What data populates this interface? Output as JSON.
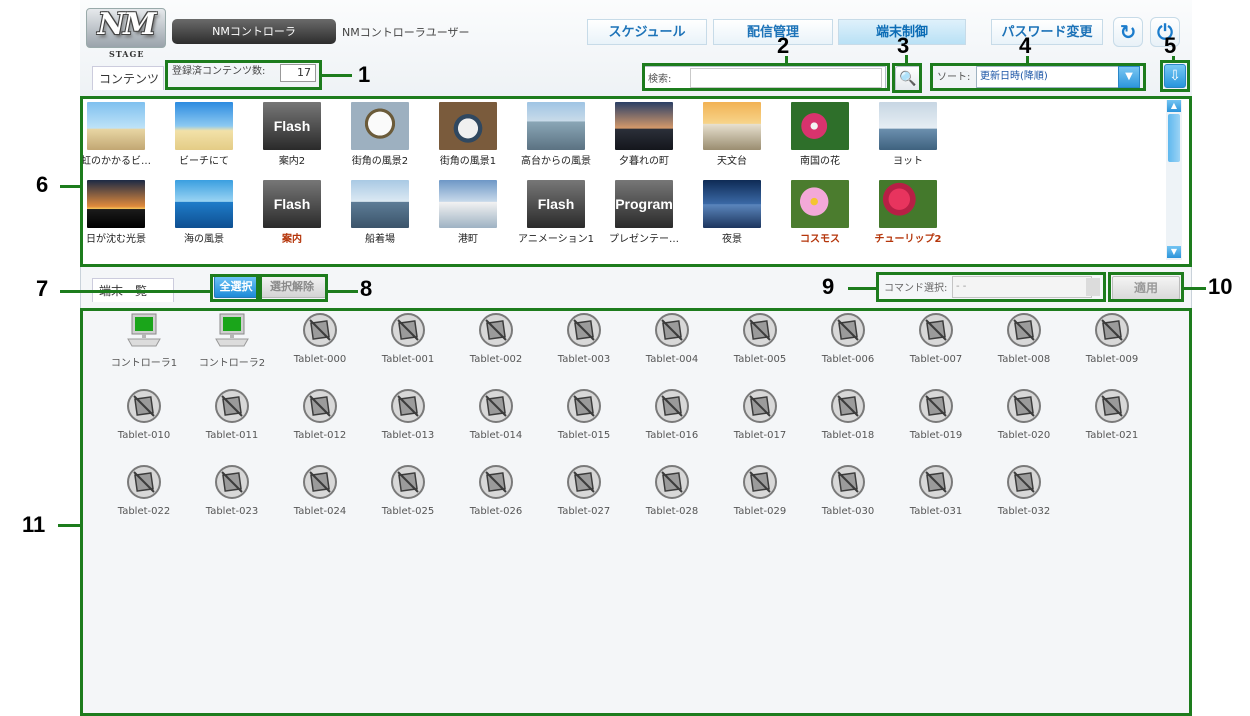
{
  "header": {
    "logo_text": "NM",
    "logo_sub": "STAGE",
    "controller_button": "NMコントローラ",
    "user_name": "NMコントローラユーザー",
    "nav": {
      "schedule": "スケジュール",
      "delivery": "配信管理",
      "terminal": "端末制御"
    },
    "password_button": "パスワード変更",
    "reload_icon": "reload-icon",
    "power_icon": "power-icon"
  },
  "content_toolbar": {
    "tab_label": "コンテンツ",
    "count_label": "登録済コンテンツ数:",
    "count_value": "17",
    "search_label": "検索:",
    "search_value": "",
    "sort_label": "ソート:",
    "sort_value": "更新日時(降順)"
  },
  "contents": [
    {
      "caption": "虹のかかるビ…",
      "kind": "palm",
      "red": false
    },
    {
      "caption": "ビーチにて",
      "kind": "beach",
      "red": false
    },
    {
      "caption": "案内2",
      "kind": "flash",
      "red": false
    },
    {
      "caption": "街角の風景2",
      "kind": "clock",
      "red": false
    },
    {
      "caption": "街角の風景1",
      "kind": "clock2",
      "red": false
    },
    {
      "caption": "高台からの風景",
      "kind": "city",
      "red": false
    },
    {
      "caption": "夕暮れの町",
      "kind": "dusk",
      "red": false
    },
    {
      "caption": "天文台",
      "kind": "dome",
      "red": false
    },
    {
      "caption": "南国の花",
      "kind": "flower",
      "red": false
    },
    {
      "caption": "ヨット",
      "kind": "yacht",
      "red": false
    },
    {
      "caption": "日が沈む光景",
      "kind": "sunset",
      "red": false
    },
    {
      "caption": "海の風景",
      "kind": "sea",
      "red": false
    },
    {
      "caption": "案内",
      "kind": "flash",
      "red": true
    },
    {
      "caption": "船着場",
      "kind": "harbor",
      "red": false
    },
    {
      "caption": "港町",
      "kind": "port",
      "red": false
    },
    {
      "caption": "アニメーション1",
      "kind": "flash",
      "red": false
    },
    {
      "caption": "プレゼンテー…",
      "kind": "program",
      "red": false
    },
    {
      "caption": "夜景",
      "kind": "night",
      "red": false
    },
    {
      "caption": "コスモス",
      "kind": "cosmos",
      "red": true
    },
    {
      "caption": "チューリップ2",
      "kind": "tulip",
      "red": true
    }
  ],
  "media_labels": {
    "flash": "Flash",
    "program": "Program"
  },
  "terminal_toolbar": {
    "tab_label": "端末一覧",
    "select_all": "全選択",
    "deselect": "選択解除",
    "command_label": "コマンド選択:",
    "command_value": "- -",
    "apply": "適用"
  },
  "terminals": [
    {
      "label": "コントローラ1",
      "kind": "pc"
    },
    {
      "label": "コントローラ2",
      "kind": "pc"
    },
    {
      "label": "Tablet-000",
      "kind": "tablet"
    },
    {
      "label": "Tablet-001",
      "kind": "tablet"
    },
    {
      "label": "Tablet-002",
      "kind": "tablet"
    },
    {
      "label": "Tablet-003",
      "kind": "tablet"
    },
    {
      "label": "Tablet-004",
      "kind": "tablet"
    },
    {
      "label": "Tablet-005",
      "kind": "tablet"
    },
    {
      "label": "Tablet-006",
      "kind": "tablet"
    },
    {
      "label": "Tablet-007",
      "kind": "tablet"
    },
    {
      "label": "Tablet-008",
      "kind": "tablet"
    },
    {
      "label": "Tablet-009",
      "kind": "tablet"
    },
    {
      "label": "Tablet-010",
      "kind": "tablet"
    },
    {
      "label": "Tablet-011",
      "kind": "tablet"
    },
    {
      "label": "Tablet-012",
      "kind": "tablet"
    },
    {
      "label": "Tablet-013",
      "kind": "tablet"
    },
    {
      "label": "Tablet-014",
      "kind": "tablet"
    },
    {
      "label": "Tablet-015",
      "kind": "tablet"
    },
    {
      "label": "Tablet-016",
      "kind": "tablet"
    },
    {
      "label": "Tablet-017",
      "kind": "tablet"
    },
    {
      "label": "Tablet-018",
      "kind": "tablet"
    },
    {
      "label": "Tablet-019",
      "kind": "tablet"
    },
    {
      "label": "Tablet-020",
      "kind": "tablet"
    },
    {
      "label": "Tablet-021",
      "kind": "tablet"
    },
    {
      "label": "Tablet-022",
      "kind": "tablet"
    },
    {
      "label": "Tablet-023",
      "kind": "tablet"
    },
    {
      "label": "Tablet-024",
      "kind": "tablet"
    },
    {
      "label": "Tablet-025",
      "kind": "tablet"
    },
    {
      "label": "Tablet-026",
      "kind": "tablet"
    },
    {
      "label": "Tablet-027",
      "kind": "tablet"
    },
    {
      "label": "Tablet-028",
      "kind": "tablet"
    },
    {
      "label": "Tablet-029",
      "kind": "tablet"
    },
    {
      "label": "Tablet-030",
      "kind": "tablet"
    },
    {
      "label": "Tablet-031",
      "kind": "tablet"
    },
    {
      "label": "Tablet-032",
      "kind": "tablet"
    }
  ],
  "callouts": [
    "1",
    "2",
    "3",
    "4",
    "5",
    "6",
    "7",
    "8",
    "9",
    "10",
    "11"
  ],
  "colors": {
    "callout": "#1d7c1d",
    "accent_blue": "#2b94da",
    "red_caption": "#b5360b"
  }
}
